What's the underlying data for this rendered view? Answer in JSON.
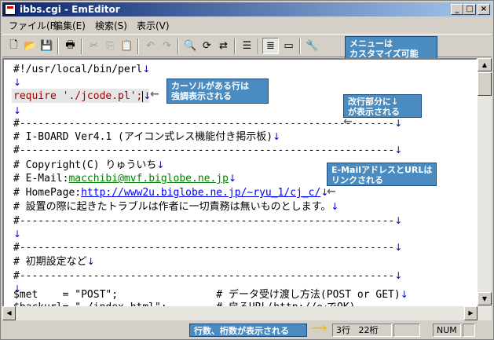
{
  "window": {
    "title": "ibbs.cgi - EmEditor"
  },
  "menu": [
    "ファイル(F)",
    "編集(E)",
    "検索(S)",
    "表示(V)"
  ],
  "toolbar": {
    "icons": [
      "new-file-icon",
      "open-folder-icon",
      "save-icon",
      "print-icon",
      "cut-icon",
      "copy-icon",
      "paste-icon",
      "undo-icon",
      "redo-icon",
      "find-icon",
      "find-next-icon",
      "replace-icon",
      "bullet-list-icon",
      "wrap-icon",
      "window-icon",
      "customize-icon"
    ]
  },
  "callouts": {
    "menu_custom": "メニューは\nカスタマイズ可能",
    "cursor_line": "カーソルがある行は\n強調表示される",
    "newline": "改行部分に↓\nが表示される",
    "url": "E-MailアドレスとURLは\nリンクされる",
    "status": "行数、桁数が表示される"
  },
  "editor": {
    "newline_mark": "↓",
    "lines": {
      "l1": "#!/usr/local/bin/perl",
      "l2": "",
      "l3": "require './jcode.pl';",
      "l4": "",
      "l5": "#-------------------------------------------------------------",
      "l6": "# I-BOARD Ver4.1 (アイコン式レス機能付き掲示板)",
      "l7": "#-------------------------------------------------------------",
      "l8": "# Copyright(C) りゅういち",
      "l9_prefix": "# E-Mail:",
      "l9_link": "macchibi@mvf.biglobe.ne.jp",
      "l10_prefix": "# HomePage:",
      "l10_link": "http://www2u.biglobe.ne.jp/~ryu_1/cj_c/",
      "l11": "# 設置の際に起きたトラブルは作者に一切責務は無いものとします。",
      "l12": "#-------------------------------------------------------------",
      "l13": "",
      "l14": "#-------------------------------------------------------------",
      "l15": "# 初期設定など",
      "l16": "#-------------------------------------------------------------",
      "l17": "",
      "l18": "$met    = \"POST\";                # データ受け渡し方法(POST or GET)",
      "l19": "$backurl= \"./index.html\";        # 戻るURL(http://～でOK)"
    }
  },
  "status": {
    "row": "3行",
    "col": "22桁",
    "mode": "NUM"
  }
}
